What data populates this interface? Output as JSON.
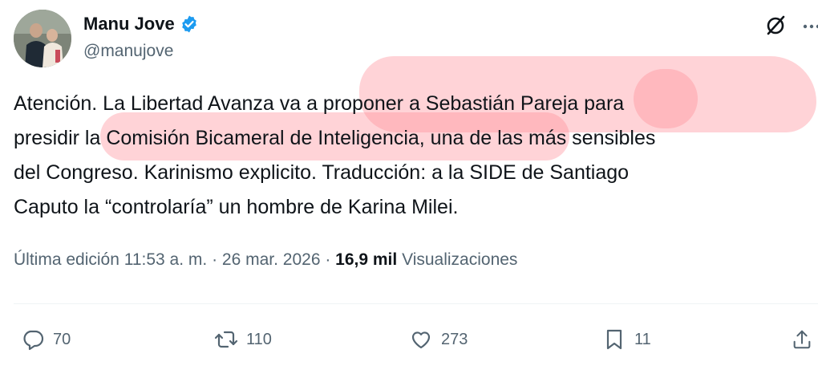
{
  "author": {
    "display_name": "Manu Jove",
    "handle": "@manujove",
    "verified": true,
    "avatar_icon": "profile-photo"
  },
  "header_icons": {
    "grok": "grok-icon",
    "more": "more-icon"
  },
  "tweet": {
    "lines": [
      "Atención. La Libertad Avanza va a proponer a Sebastián Pareja para",
      "presidir la Comisión Bicameral de Inteligencia, una de las más sensibles",
      "del Congreso. Karinismo explicito. Traducción: a la SIDE de Santiago",
      "Caputo la “controlaría” un hombre de Karina Milei."
    ]
  },
  "meta": {
    "edited_label": "Última edición 11:53 a. m.",
    "separator1": " · ",
    "date": "26 mar. 2026",
    "separator2": " · ",
    "views_count": "16,9 mil",
    "views_label": " Visualizaciones"
  },
  "actions": {
    "replies": "70",
    "reposts": "110",
    "likes": "273",
    "bookmarks": "11"
  },
  "colors": {
    "text_primary": "#0f1419",
    "text_secondary": "#536471",
    "verified_blue": "#1d9bf0",
    "highlight": "#ff8c96"
  }
}
